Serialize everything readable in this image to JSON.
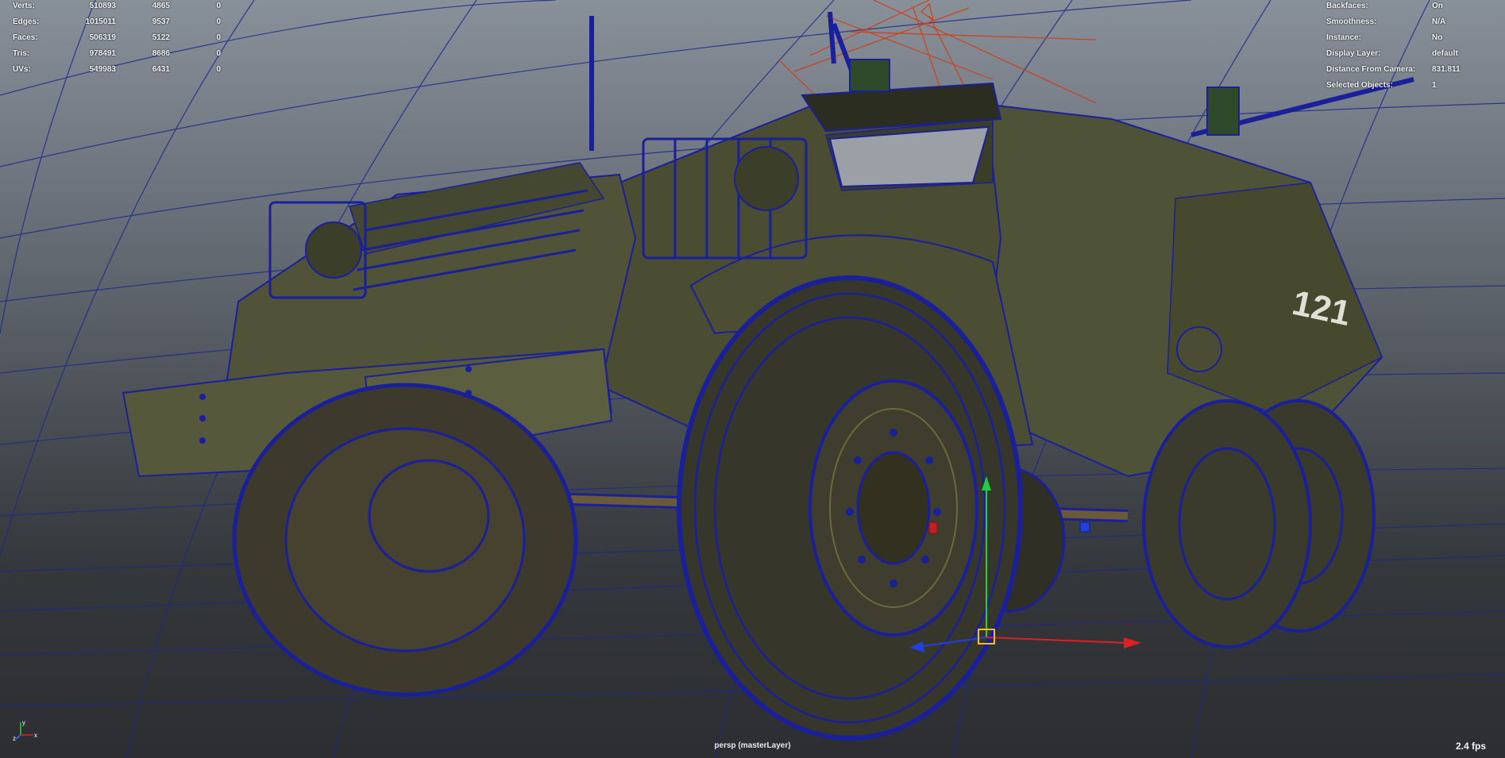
{
  "viewport": {
    "background_top": "#88909a",
    "background_bottom": "#2c2e31",
    "wireframe_color": "#1a1f9c",
    "hull_color": "#4e5236",
    "camera_label": "persp (masterLayer)",
    "fps": "2.4 fps",
    "vehicle_number": "121"
  },
  "heads_up_stats": [
    {
      "label": "Verts:",
      "c1": "510893",
      "c2": "4865",
      "c3": "0"
    },
    {
      "label": "Edges:",
      "c1": "1015011",
      "c2": "9537",
      "c3": "0"
    },
    {
      "label": "Faces:",
      "c1": "506319",
      "c2": "5122",
      "c3": "0"
    },
    {
      "label": "Tris:",
      "c1": "978491",
      "c2": "8686",
      "c3": "0"
    },
    {
      "label": "UVs:",
      "c1": "549983",
      "c2": "6431",
      "c3": "0"
    }
  ],
  "heads_up_info": [
    {
      "label": "Backfaces:",
      "value": "On"
    },
    {
      "label": "Smoothness:",
      "value": "N/A"
    },
    {
      "label": "Instance:",
      "value": "No"
    },
    {
      "label": "Display Layer:",
      "value": "default"
    },
    {
      "label": "Distance From Camera:",
      "value": "831.811"
    },
    {
      "label": "Selected Objects:",
      "value": "1"
    }
  ],
  "axis_indicator": {
    "x": "x",
    "y": "y",
    "z": "z"
  },
  "manipulator": {
    "x_color": "#e02020",
    "y_color": "#20d040",
    "z_color": "#2040e0",
    "center_color": "#f0c020"
  }
}
